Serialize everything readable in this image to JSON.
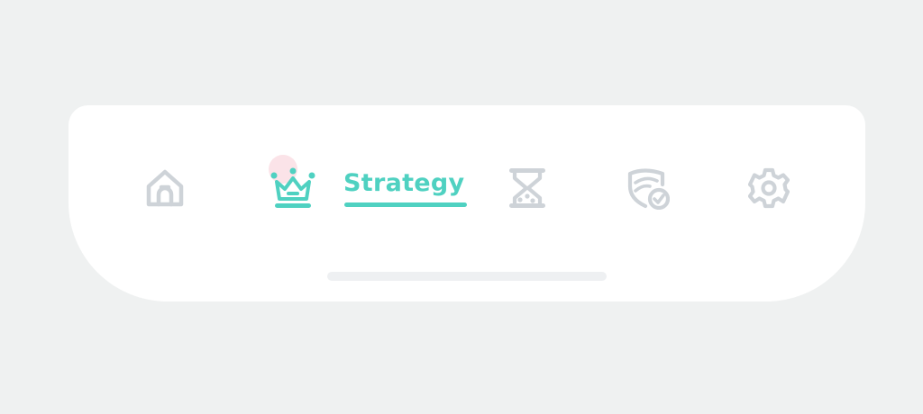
{
  "tabbar": {
    "active_tab": "strategy",
    "tabs": [
      {
        "id": "home",
        "icon": "house-icon"
      },
      {
        "id": "strategy",
        "icon": "crown-icon",
        "label": "Strategy"
      },
      {
        "id": "time",
        "icon": "hourglass-icon"
      },
      {
        "id": "security",
        "icon": "shield-check-icon"
      },
      {
        "id": "settings",
        "icon": "gear-icon"
      }
    ]
  },
  "colors": {
    "accent": "#4fd1c1",
    "inactive_icon": "#ced3d8",
    "notification_dot": "#fbe3e8",
    "background": "#eff1f1",
    "bar": "#ffffff",
    "home_indicator": "#eef0f2"
  }
}
